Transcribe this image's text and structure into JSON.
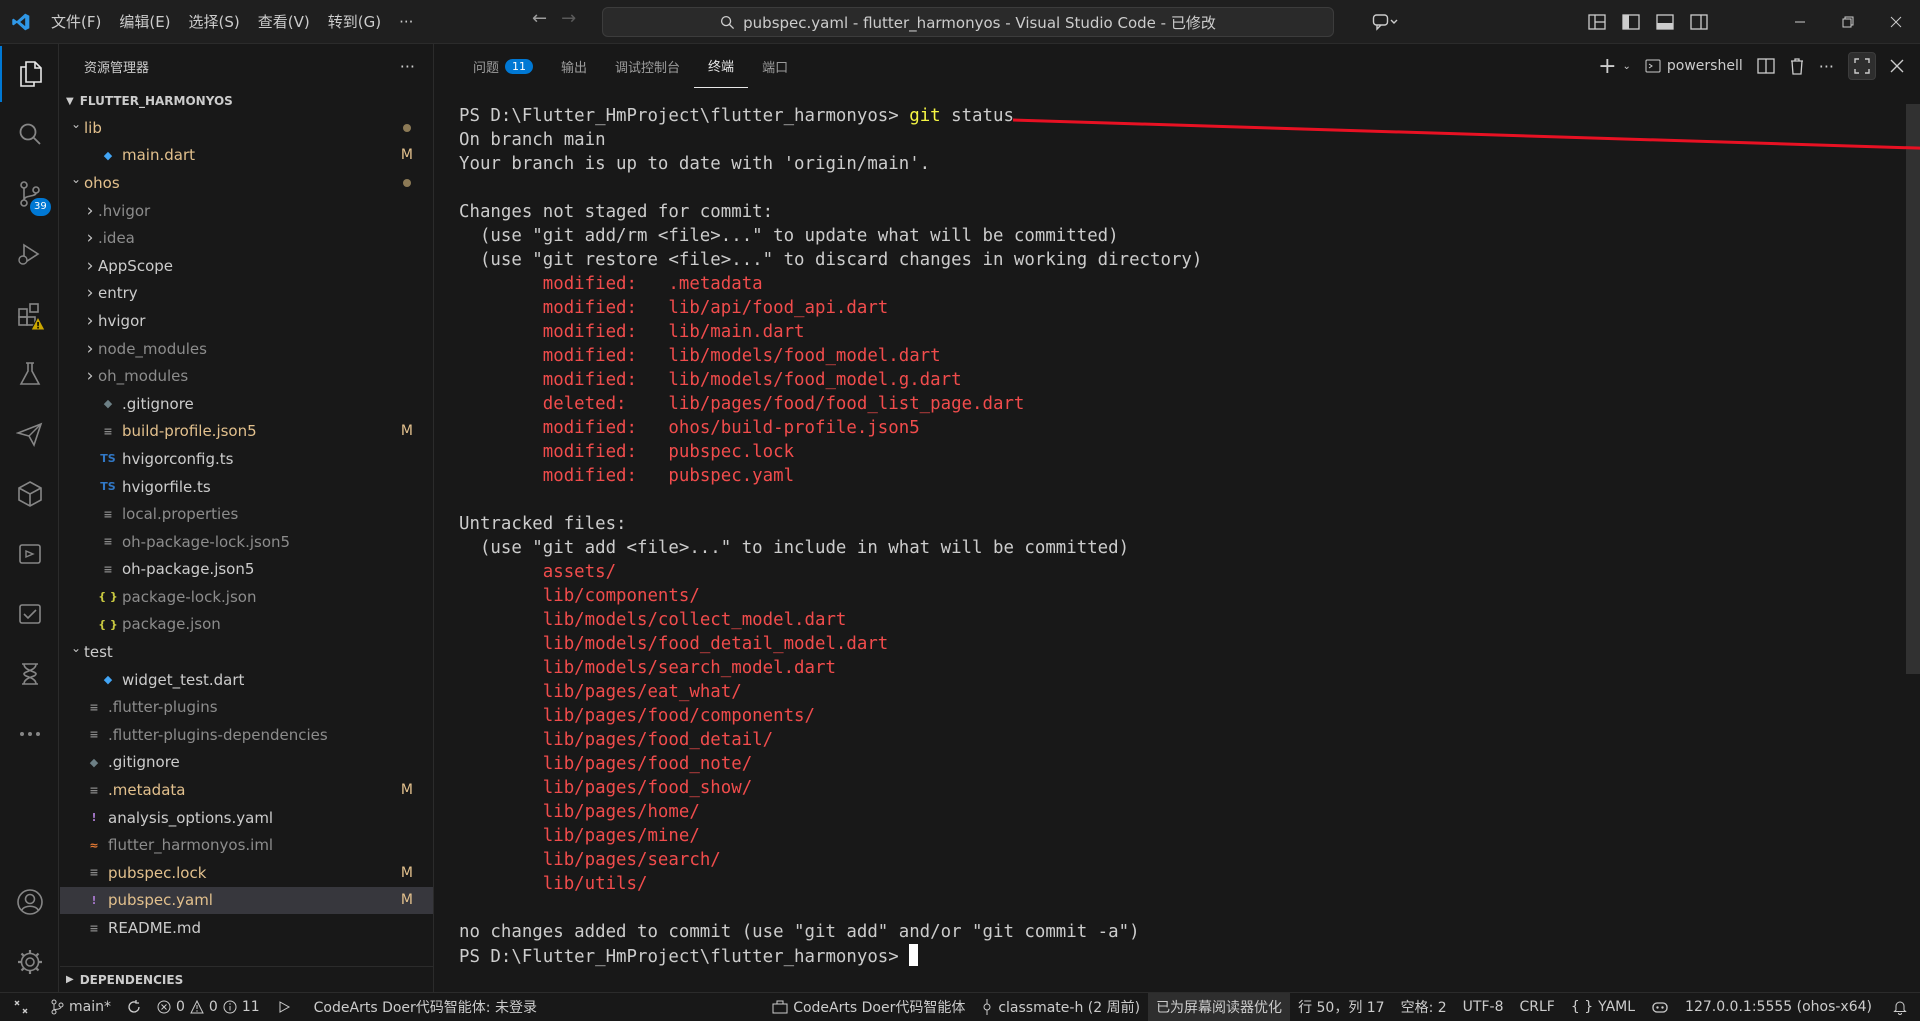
{
  "window": {
    "title": "pubspec.yaml - flutter_harmonyos - Visual Studio Code - 已修改"
  },
  "menu": [
    "文件(F)",
    "编辑(E)",
    "选择(S)",
    "查看(V)",
    "转到(G)",
    "···"
  ],
  "activity": {
    "scm_badge": "39"
  },
  "sidebar": {
    "title": "资源管理器",
    "root": "FLUTTER_HARMONYOS",
    "footer_section": "DEPENDENCIES",
    "tree": [
      {
        "label": "lib",
        "indent": 1,
        "chev": "down",
        "icon": "",
        "color": "mod",
        "status": "dot"
      },
      {
        "label": "main.dart",
        "indent": 2,
        "chev": "",
        "icon": "dart",
        "color": "mod",
        "status": "M"
      },
      {
        "label": "ohos",
        "indent": 1,
        "chev": "down",
        "icon": "",
        "color": "mod",
        "status": "dot"
      },
      {
        "label": ".hvigor",
        "indent": 2,
        "chev": "right",
        "icon": "",
        "color": "ign",
        "status": ""
      },
      {
        "label": ".idea",
        "indent": 2,
        "chev": "right",
        "icon": "",
        "color": "ign",
        "status": ""
      },
      {
        "label": "AppScope",
        "indent": 2,
        "chev": "right",
        "icon": "",
        "color": "norm",
        "status": ""
      },
      {
        "label": "entry",
        "indent": 2,
        "chev": "right",
        "icon": "",
        "color": "norm",
        "status": ""
      },
      {
        "label": "hvigor",
        "indent": 2,
        "chev": "right",
        "icon": "",
        "color": "norm",
        "status": ""
      },
      {
        "label": "node_modules",
        "indent": 2,
        "chev": "right",
        "icon": "",
        "color": "ign",
        "status": ""
      },
      {
        "label": "oh_modules",
        "indent": 2,
        "chev": "right",
        "icon": "",
        "color": "ign",
        "status": ""
      },
      {
        "label": ".gitignore",
        "indent": 2,
        "chev": "",
        "icon": "git",
        "color": "norm",
        "status": ""
      },
      {
        "label": "build-profile.json5",
        "indent": 2,
        "chev": "",
        "icon": "lines",
        "color": "mod",
        "status": "M"
      },
      {
        "label": "hvigorconfig.ts",
        "indent": 2,
        "chev": "",
        "icon": "ts",
        "color": "norm",
        "status": ""
      },
      {
        "label": "hvigorfile.ts",
        "indent": 2,
        "chev": "",
        "icon": "ts",
        "color": "norm",
        "status": ""
      },
      {
        "label": "local.properties",
        "indent": 2,
        "chev": "",
        "icon": "lines",
        "color": "ign",
        "status": ""
      },
      {
        "label": "oh-package-lock.json5",
        "indent": 2,
        "chev": "",
        "icon": "lines",
        "color": "ign",
        "status": ""
      },
      {
        "label": "oh-package.json5",
        "indent": 2,
        "chev": "",
        "icon": "lines",
        "color": "norm",
        "status": ""
      },
      {
        "label": "package-lock.json",
        "indent": 2,
        "chev": "",
        "icon": "json",
        "color": "ign",
        "status": ""
      },
      {
        "label": "package.json",
        "indent": 2,
        "chev": "",
        "icon": "json",
        "color": "ign",
        "status": ""
      },
      {
        "label": "test",
        "indent": 1,
        "chev": "down",
        "icon": "",
        "color": "norm",
        "status": ""
      },
      {
        "label": "widget_test.dart",
        "indent": 2,
        "chev": "",
        "icon": "dart",
        "color": "norm",
        "status": ""
      },
      {
        "label": ".flutter-plugins",
        "indent": 1,
        "chev": "",
        "icon": "lines",
        "color": "ign",
        "status": ""
      },
      {
        "label": ".flutter-plugins-dependencies",
        "indent": 1,
        "chev": "",
        "icon": "lines",
        "color": "ign",
        "status": ""
      },
      {
        "label": ".gitignore",
        "indent": 1,
        "chev": "",
        "icon": "git",
        "color": "norm",
        "status": ""
      },
      {
        "label": ".metadata",
        "indent": 1,
        "chev": "",
        "icon": "lines",
        "color": "mod",
        "status": "M"
      },
      {
        "label": "analysis_options.yaml",
        "indent": 1,
        "chev": "",
        "icon": "yaml",
        "color": "norm",
        "status": ""
      },
      {
        "label": "flutter_harmonyos.iml",
        "indent": 1,
        "chev": "",
        "icon": "rss",
        "color": "ign",
        "status": ""
      },
      {
        "label": "pubspec.lock",
        "indent": 1,
        "chev": "",
        "icon": "lines",
        "color": "mod",
        "status": "M"
      },
      {
        "label": "pubspec.yaml",
        "indent": 1,
        "chev": "",
        "icon": "yaml",
        "color": "mod",
        "status": "M",
        "selected": true
      },
      {
        "label": "README.md",
        "indent": 1,
        "chev": "",
        "icon": "lines",
        "color": "norm",
        "status": ""
      }
    ]
  },
  "panel": {
    "tabs": [
      {
        "label": "问题",
        "count": "11",
        "active": false
      },
      {
        "label": "输出",
        "active": false
      },
      {
        "label": "调试控制台",
        "active": false
      },
      {
        "label": "终端",
        "active": true
      },
      {
        "label": "端口",
        "active": false
      }
    ],
    "shell_label": "powershell"
  },
  "terminal": {
    "lines": [
      [
        {
          "t": "PS D:\\Flutter_HmProject\\flutter_harmonyos> "
        },
        {
          "t": "git",
          "c": "yellow"
        },
        {
          "t": " status"
        }
      ],
      [
        {
          "t": "On branch main"
        }
      ],
      [
        {
          "t": "Your branch is up to date with 'origin/main'."
        }
      ],
      [
        {
          "t": ""
        }
      ],
      [
        {
          "t": "Changes not staged for commit:"
        }
      ],
      [
        {
          "t": "  (use \"git add/rm <file>...\" to update what will be committed)"
        }
      ],
      [
        {
          "t": "  (use \"git restore <file>...\" to discard changes in working directory)"
        }
      ],
      [
        {
          "t": "        "
        },
        {
          "t": "modified:   .metadata",
          "c": "red"
        }
      ],
      [
        {
          "t": "        "
        },
        {
          "t": "modified:   lib/api/food_api.dart",
          "c": "red"
        }
      ],
      [
        {
          "t": "        "
        },
        {
          "t": "modified:   lib/main.dart",
          "c": "red"
        }
      ],
      [
        {
          "t": "        "
        },
        {
          "t": "modified:   lib/models/food_model.dart",
          "c": "red"
        }
      ],
      [
        {
          "t": "        "
        },
        {
          "t": "modified:   lib/models/food_model.g.dart",
          "c": "red"
        }
      ],
      [
        {
          "t": "        "
        },
        {
          "t": "deleted:    lib/pages/food/food_list_page.dart",
          "c": "red"
        }
      ],
      [
        {
          "t": "        "
        },
        {
          "t": "modified:   ohos/build-profile.json5",
          "c": "red"
        }
      ],
      [
        {
          "t": "        "
        },
        {
          "t": "modified:   pubspec.lock",
          "c": "red"
        }
      ],
      [
        {
          "t": "        "
        },
        {
          "t": "modified:   pubspec.yaml",
          "c": "red"
        }
      ],
      [
        {
          "t": ""
        }
      ],
      [
        {
          "t": "Untracked files:"
        }
      ],
      [
        {
          "t": "  (use \"git add <file>...\" to include in what will be committed)"
        }
      ],
      [
        {
          "t": "        "
        },
        {
          "t": "assets/",
          "c": "red"
        }
      ],
      [
        {
          "t": "        "
        },
        {
          "t": "lib/components/",
          "c": "red"
        }
      ],
      [
        {
          "t": "        "
        },
        {
          "t": "lib/models/collect_model.dart",
          "c": "red"
        }
      ],
      [
        {
          "t": "        "
        },
        {
          "t": "lib/models/food_detail_model.dart",
          "c": "red"
        }
      ],
      [
        {
          "t": "        "
        },
        {
          "t": "lib/models/search_model.dart",
          "c": "red"
        }
      ],
      [
        {
          "t": "        "
        },
        {
          "t": "lib/pages/eat_what/",
          "c": "red"
        }
      ],
      [
        {
          "t": "        "
        },
        {
          "t": "lib/pages/food/components/",
          "c": "red"
        }
      ],
      [
        {
          "t": "        "
        },
        {
          "t": "lib/pages/food_detail/",
          "c": "red"
        }
      ],
      [
        {
          "t": "        "
        },
        {
          "t": "lib/pages/food_note/",
          "c": "red"
        }
      ],
      [
        {
          "t": "        "
        },
        {
          "t": "lib/pages/food_show/",
          "c": "red"
        }
      ],
      [
        {
          "t": "        "
        },
        {
          "t": "lib/pages/home/",
          "c": "red"
        }
      ],
      [
        {
          "t": "        "
        },
        {
          "t": "lib/pages/mine/",
          "c": "red"
        }
      ],
      [
        {
          "t": "        "
        },
        {
          "t": "lib/pages/search/",
          "c": "red"
        }
      ],
      [
        {
          "t": "        "
        },
        {
          "t": "lib/utils/",
          "c": "red"
        }
      ],
      [
        {
          "t": ""
        }
      ],
      [
        {
          "t": "no changes added to commit (use \"git add\" and/or \"git commit -a\")"
        }
      ],
      [
        {
          "t": "PS D:\\Flutter_HmProject\\flutter_harmonyos> "
        },
        {
          "cursor": true
        }
      ]
    ]
  },
  "statusbar": {
    "branch": "main*",
    "errors": "0",
    "warnings": "0",
    "infos": "11",
    "codearts_left": "CodeArts Doer代码智能体: 未登录",
    "codearts_right": "CodeArts Doer代码智能体",
    "classmate": "classmate-h (2 周前)",
    "screen_reader": "已为屏幕阅读器优化",
    "position": "行 50，列 17",
    "spaces": "空格: 2",
    "encoding": "UTF-8",
    "eol": "CRLF",
    "language": "YAML",
    "remote": "127.0.0.1:5555 (ohos-x64)"
  },
  "colors": {
    "accent": "#0078d4",
    "modified": "#e2c08d",
    "term_red": "#f14c4c",
    "term_yellow": "#f5f543",
    "arrow": "#e81123"
  }
}
